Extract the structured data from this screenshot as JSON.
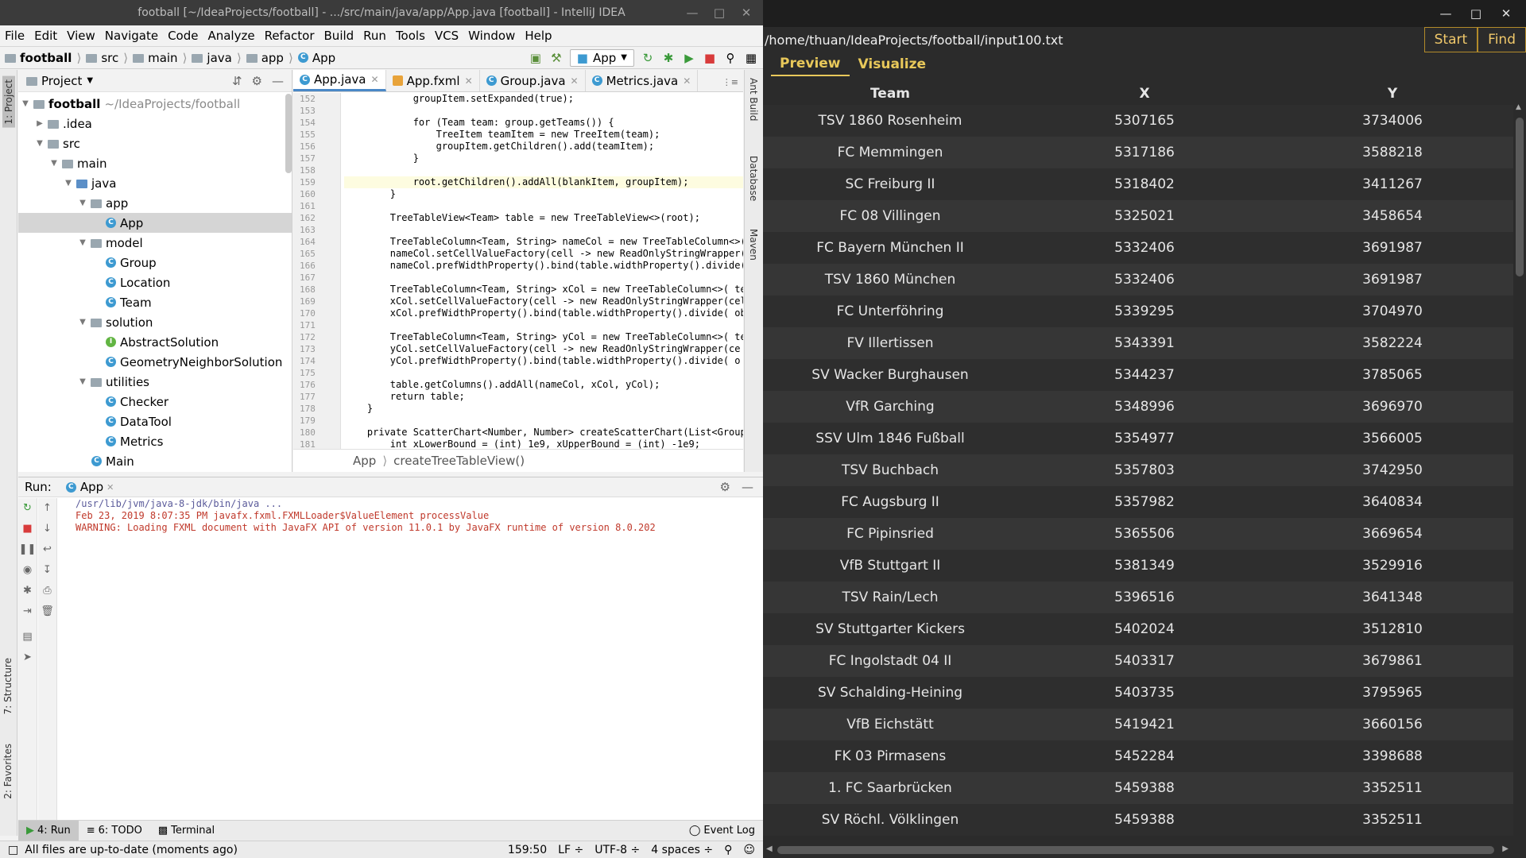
{
  "intellij": {
    "title": "football [~/IdeaProjects/football] - .../src/main/java/app/App.java [football] - IntelliJ IDEA",
    "menu": [
      "File",
      "Edit",
      "View",
      "Navigate",
      "Code",
      "Analyze",
      "Refactor",
      "Build",
      "Run",
      "Tools",
      "VCS",
      "Window",
      "Help"
    ],
    "breadcrumb": [
      "football",
      "src",
      "main",
      "java",
      "app",
      "App"
    ],
    "run_config": "App",
    "project_panel": {
      "title": "Project",
      "root_name": "football",
      "root_path": "~/IdeaProjects/football",
      "items": [
        {
          "label": "football",
          "type": "root"
        },
        {
          "label": ".idea",
          "type": "folder"
        },
        {
          "label": "src",
          "type": "folder"
        },
        {
          "label": "main",
          "type": "folder"
        },
        {
          "label": "java",
          "type": "folder"
        },
        {
          "label": "app",
          "type": "folder"
        },
        {
          "label": "App",
          "type": "class"
        },
        {
          "label": "model",
          "type": "folder"
        },
        {
          "label": "Group",
          "type": "class"
        },
        {
          "label": "Location",
          "type": "class"
        },
        {
          "label": "Team",
          "type": "class"
        },
        {
          "label": "solution",
          "type": "folder"
        },
        {
          "label": "AbstractSolution",
          "type": "abstract"
        },
        {
          "label": "GeometryNeighborSolution",
          "type": "class"
        },
        {
          "label": "utilities",
          "type": "folder"
        },
        {
          "label": "Checker",
          "type": "class"
        },
        {
          "label": "DataTool",
          "type": "class"
        },
        {
          "label": "Metrics",
          "type": "class"
        },
        {
          "label": "Main",
          "type": "class"
        }
      ]
    },
    "editor_tabs": [
      "App.java",
      "App.fxml",
      "Group.java",
      "Metrics.java"
    ],
    "tab_overflow": "⋮≡",
    "line_numbers": [
      "152",
      "153",
      "154",
      "155",
      "156",
      "157",
      "158",
      "159",
      "160",
      "161",
      "162",
      "163",
      "164",
      "165",
      "166",
      "167",
      "168",
      "169",
      "170",
      "171",
      "172",
      "173",
      "174",
      "175",
      "176",
      "177",
      "178",
      "179",
      "180",
      "181"
    ],
    "code_lines": [
      "            groupItem.setExpanded(true);",
      "",
      "            for (Team team: group.getTeams()) {",
      "                TreeItem teamItem = new TreeItem(team);",
      "                groupItem.getChildren().add(teamItem);",
      "            }",
      "",
      "            root.getChildren().addAll(blankItem, groupItem);",
      "        }",
      "",
      "        TreeTableView<Team> table = new TreeTableView<>(root);",
      "",
      "        TreeTableColumn<Team, String> nameCol = new TreeTableColumn<>(",
      "        nameCol.setCellValueFactory(cell -> new ReadOnlyStringWrapper(c",
      "        nameCol.prefWidthProperty().bind(table.widthProperty().divide(",
      "",
      "        TreeTableColumn<Team, String> xCol = new TreeTableColumn<>( tex",
      "        xCol.setCellValueFactory(cell -> new ReadOnlyStringWrapper(cell",
      "        xCol.prefWidthProperty().bind(table.widthProperty().divide( ob",
      "",
      "        TreeTableColumn<Team, String> yCol = new TreeTableColumn<>( te",
      "        yCol.setCellValueFactory(cell -> new ReadOnlyStringWrapper(ce",
      "        yCol.prefWidthProperty().bind(table.widthProperty().divide( o",
      "",
      "        table.getColumns().addAll(nameCol, xCol, yCol);",
      "        return table;",
      "    }",
      "",
      "    private ScatterChart<Number, Number> createScatterChart(List<Group",
      "        int xLowerBound = (int) 1e9, xUpperBound = (int) -1e9;"
    ],
    "editor_breadcrumb": [
      "App",
      "createTreeTableView()"
    ],
    "right_strip": [
      "Ant Build",
      "Database",
      "Maven"
    ],
    "left_strip": [
      "1: Project",
      "7: Structure",
      "2: Favorites"
    ],
    "run_panel": {
      "label": "Run:",
      "tab": "App",
      "console": [
        "/usr/lib/jvm/java-8-jdk/bin/java ...",
        "Feb 23, 2019 8:07:35 PM javafx.fxml.FXMLLoader$ValueElement processValue",
        "WARNING: Loading FXML document with JavaFX API of version 11.0.1 by JavaFX runtime of version 8.0.202"
      ]
    },
    "bottom_tabs": [
      "4: Run",
      "6: TODO",
      "Terminal"
    ],
    "event_log": "Event Log",
    "status": {
      "message": "All files are up-to-date (moments ago)",
      "position": "159:50",
      "line_sep": "LF ÷",
      "encoding": "UTF-8 ÷",
      "indent": "4 spaces ÷"
    }
  },
  "fx": {
    "path": "/home/thuan/IdeaProjects/football/input100.txt",
    "start_label": "Start",
    "find_label": "Find",
    "tabs": [
      "Preview",
      "Visualize"
    ],
    "columns": [
      "Team",
      "X",
      "Y"
    ],
    "rows": [
      [
        "TSV 1860 Rosenheim",
        "5307165",
        "3734006"
      ],
      [
        "FC Memmingen",
        "5317186",
        "3588218"
      ],
      [
        "SC Freiburg II",
        "5318402",
        "3411267"
      ],
      [
        "FC 08 Villingen",
        "5325021",
        "3458654"
      ],
      [
        "FC Bayern München II",
        "5332406",
        "3691987"
      ],
      [
        "TSV 1860 München",
        "5332406",
        "3691987"
      ],
      [
        "FC Unterföhring",
        "5339295",
        "3704970"
      ],
      [
        "FV Illertissen",
        "5343391",
        "3582224"
      ],
      [
        "SV Wacker Burghausen",
        "5344237",
        "3785065"
      ],
      [
        "VfR Garching",
        "5348996",
        "3696970"
      ],
      [
        "SSV Ulm 1846 Fußball",
        "5354977",
        "3566005"
      ],
      [
        "TSV Buchbach",
        "5357803",
        "3742950"
      ],
      [
        "FC Augsburg II",
        "5357982",
        "3640834"
      ],
      [
        "FC Pipinsried",
        "5365506",
        "3669654"
      ],
      [
        "VfB Stuttgart II",
        "5381349",
        "3529916"
      ],
      [
        "TSV Rain/Lech",
        "5396516",
        "3641348"
      ],
      [
        "SV Stuttgarter Kickers",
        "5402024",
        "3512810"
      ],
      [
        "FC Ingolstadt 04 II",
        "5403317",
        "3679861"
      ],
      [
        "SV Schalding-Heining",
        "5403735",
        "3795965"
      ],
      [
        "VfB Eichstätt",
        "5419421",
        "3660156"
      ],
      [
        "FK 03 Pirmasens",
        "5452284",
        "3398688"
      ],
      [
        "1. FC Saarbrücken",
        "5459388",
        "3352511"
      ],
      [
        "SV Röchl. Völklingen",
        "5459388",
        "3352511"
      ]
    ]
  }
}
